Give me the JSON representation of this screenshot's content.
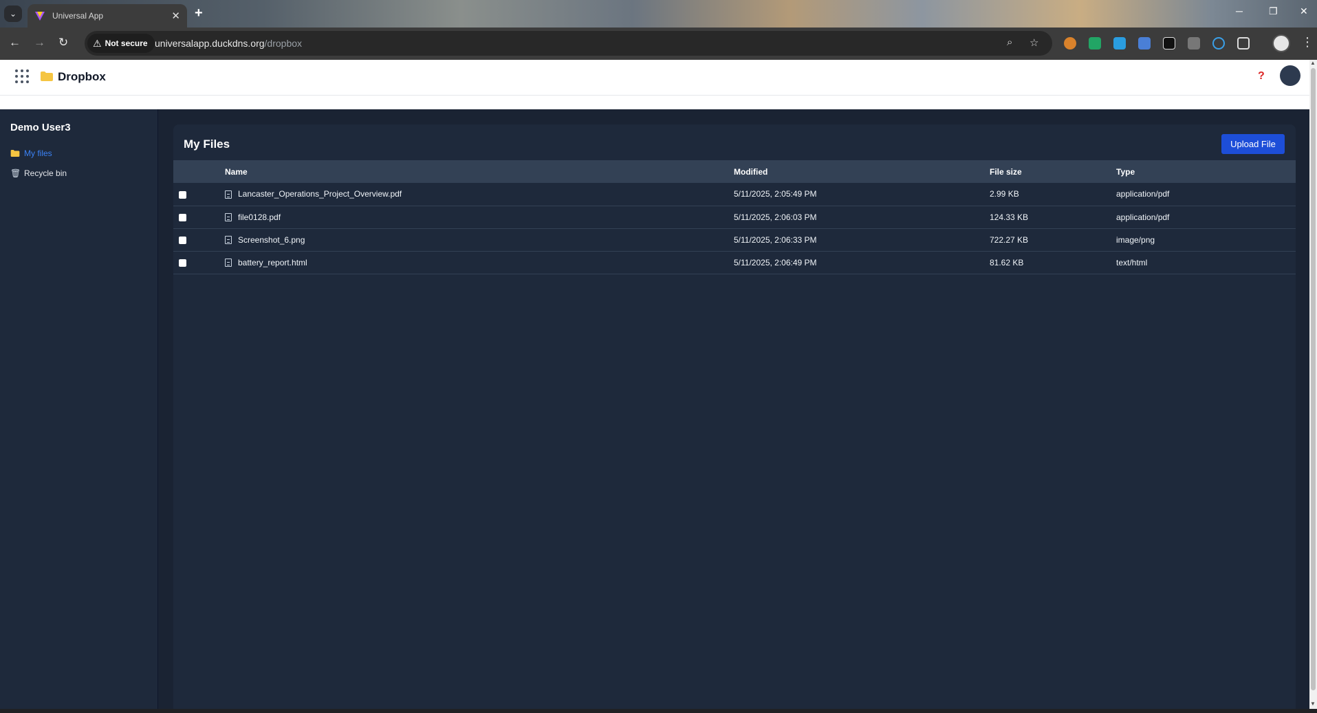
{
  "browser": {
    "tab_title": "Universal App",
    "tab_new": "+",
    "tab_close": "✕",
    "security_label": "Not secure",
    "url_host": "universalapp.duckdns.org",
    "url_path": "/dropbox",
    "window_controls": {
      "minimize": "─",
      "restore": "❐",
      "close": "✕"
    }
  },
  "app": {
    "title": "Dropbox",
    "help": "?"
  },
  "sidebar": {
    "user_name": "Demo User3",
    "items": [
      {
        "label": "My files",
        "icon": "folder-icon",
        "active": true
      },
      {
        "label": "Recycle bin",
        "icon": "trash-icon",
        "active": false
      }
    ]
  },
  "main": {
    "title": "My Files",
    "upload_label": "Upload File",
    "columns": [
      "Name",
      "Modified",
      "File size",
      "Type"
    ],
    "files": [
      {
        "name": "Lancaster_Operations_Project_Overview.pdf",
        "modified": "5/11/2025, 2:05:49 PM",
        "size": "2.99 KB",
        "type": "application/pdf"
      },
      {
        "name": "file0128.pdf",
        "modified": "5/11/2025, 2:06:03 PM",
        "size": "124.33 KB",
        "type": "application/pdf"
      },
      {
        "name": "Screenshot_6.png",
        "modified": "5/11/2025, 2:06:33 PM",
        "size": "722.27 KB",
        "type": "image/png"
      },
      {
        "name": "battery_report.html",
        "modified": "5/11/2025, 2:06:49 PM",
        "size": "81.62 KB",
        "type": "text/html"
      }
    ]
  },
  "colors": {
    "accent": "#1d4ed8",
    "active_nav": "#3b82f6",
    "sidebar_bg": "#1e293b",
    "header_row_bg": "#334155",
    "folder": "#f5c542"
  }
}
